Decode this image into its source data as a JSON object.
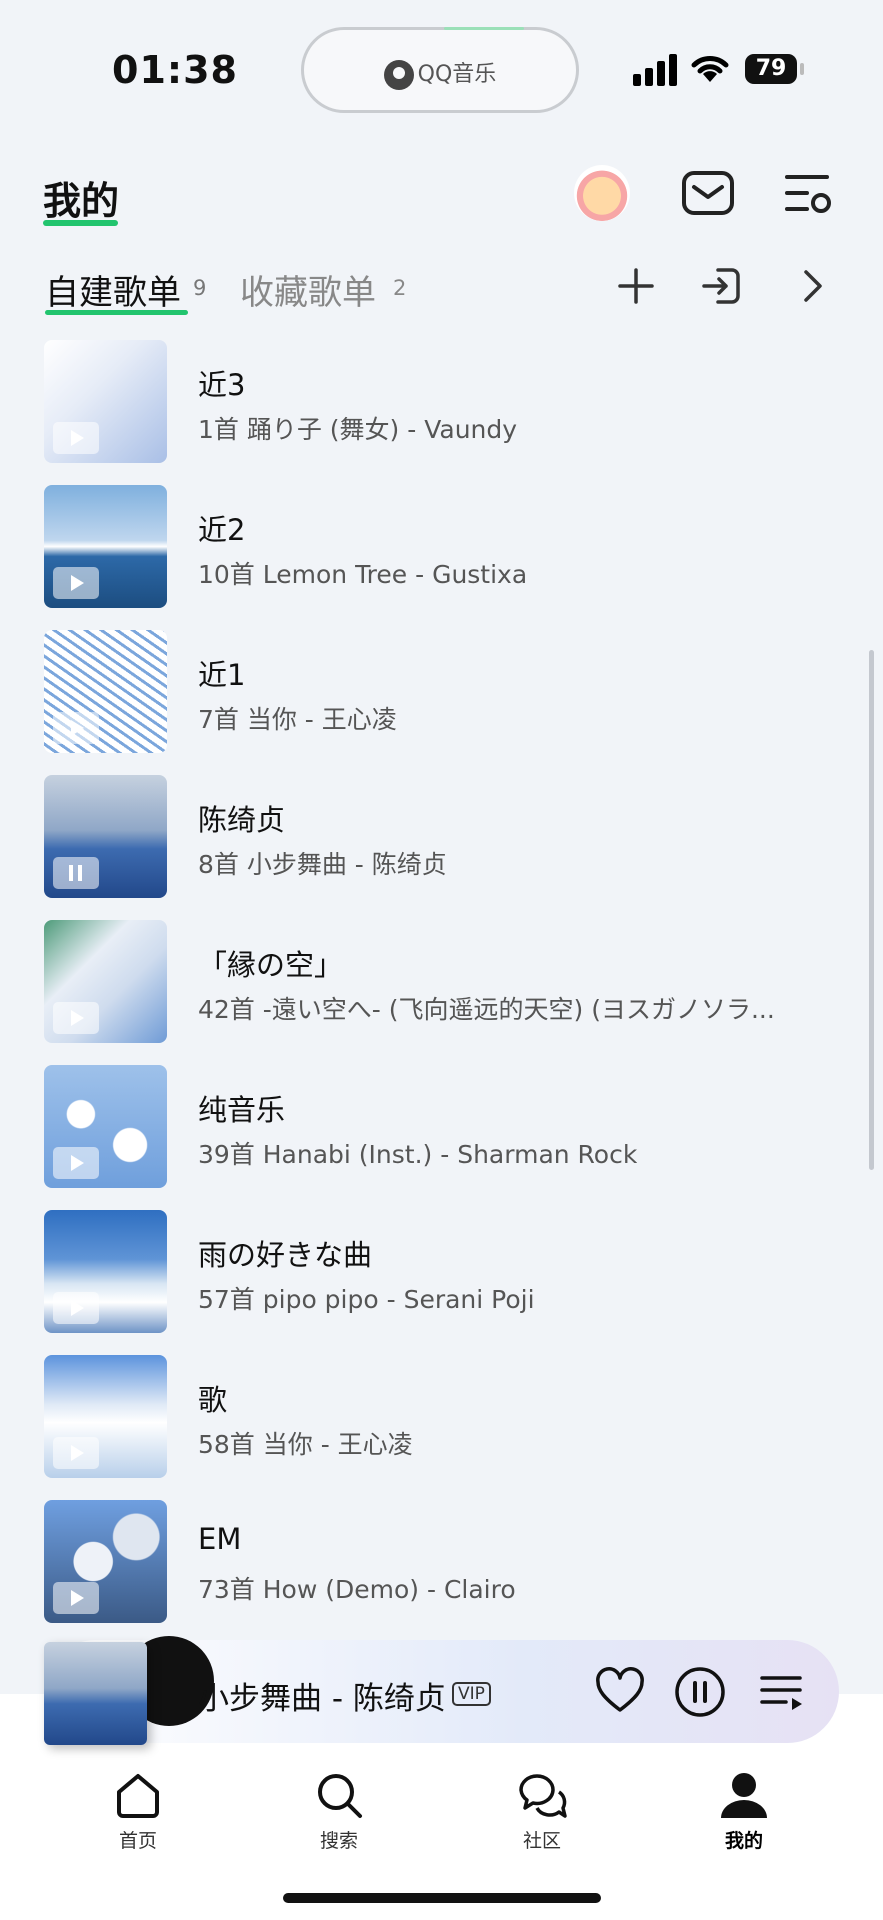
{
  "status_bar": {
    "time": "01:38",
    "island_app": "QQ音乐",
    "battery": "79"
  },
  "header": {
    "title": "我的"
  },
  "tabs": {
    "own": {
      "label": "自建歌单",
      "count": "9"
    },
    "fav": {
      "label": "收藏歌单",
      "count": "2"
    }
  },
  "playlists": [
    {
      "title": "近3",
      "subtitle": "1首 踊り子 (舞女) - Vaundy",
      "state": "play"
    },
    {
      "title": "近2",
      "subtitle": "10首 Lemon Tree - Gustixa",
      "state": "play"
    },
    {
      "title": "近1",
      "subtitle": "7首 当你 - 王心凌",
      "state": "play"
    },
    {
      "title": "陈绮贞",
      "subtitle": "8首 小步舞曲 - 陈绮贞",
      "state": "pause"
    },
    {
      "title": "「縁の空」",
      "subtitle": "42首 -遠い空へ- (飞向遥远的天空) (ヨスガノソラ...",
      "state": "play"
    },
    {
      "title": "纯音乐",
      "subtitle": "39首 Hanabi (Inst.) - Sharman Rock",
      "state": "play"
    },
    {
      "title": "雨の好きな曲",
      "subtitle": "57首 pipo pipo - Serani Poji",
      "state": "play"
    },
    {
      "title": "歌",
      "subtitle": "58首 当你 - 王心凌",
      "state": "play"
    },
    {
      "title": "EM",
      "subtitle": "73首 How (Demo) - Clairo",
      "state": "play"
    }
  ],
  "player": {
    "now_playing": "小步舞曲 - 陈绮贞",
    "badge": "VIP"
  },
  "tabbar": {
    "home": "首页",
    "search": "搜索",
    "community": "社区",
    "mine": "我的"
  },
  "colors": {
    "accent": "#22c46e",
    "background": "#f1f4f8"
  }
}
